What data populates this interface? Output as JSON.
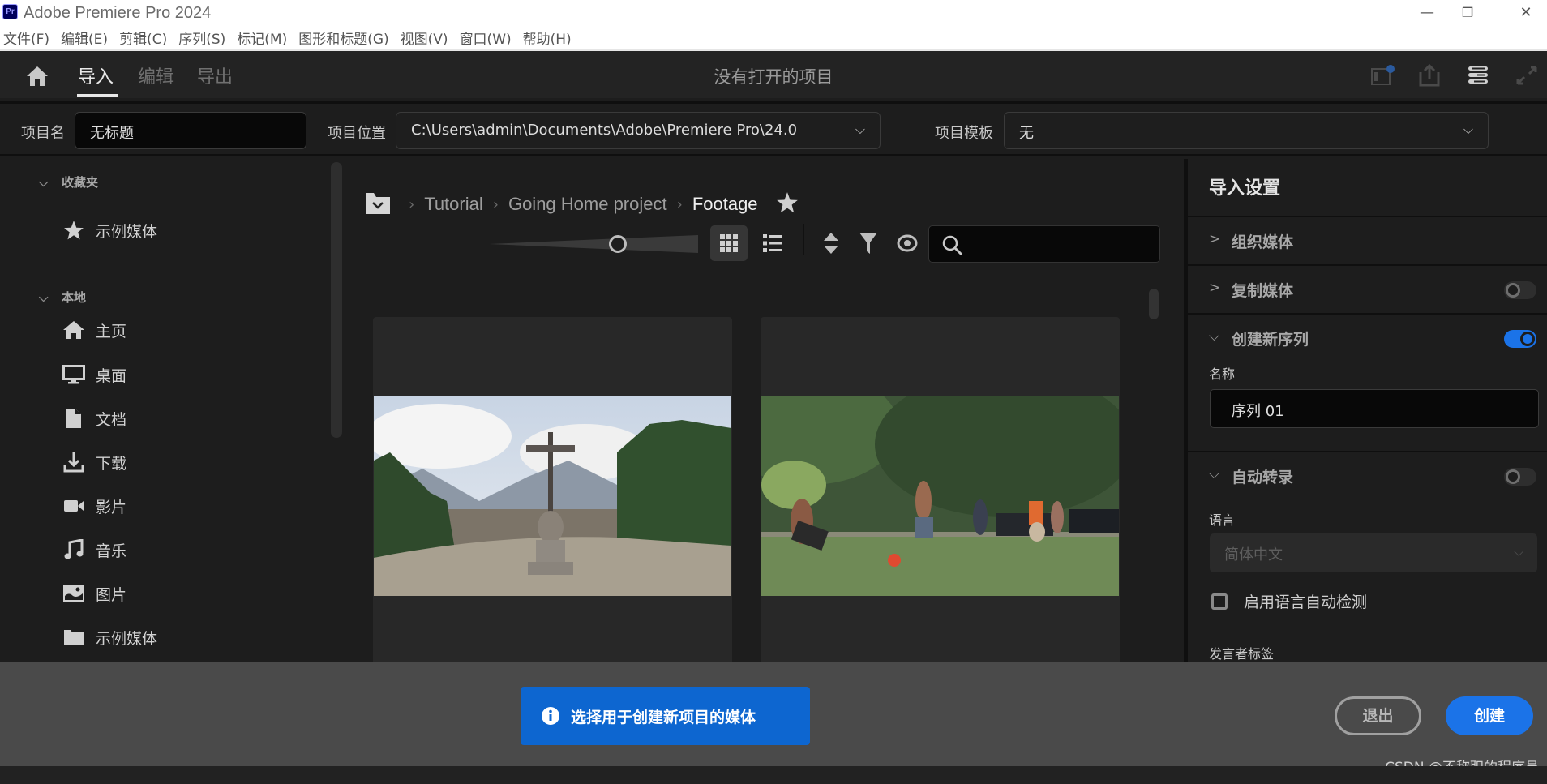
{
  "window": {
    "title": "Adobe Premiere Pro 2024",
    "logo_text": "Pr",
    "controls": {
      "minimize": "—",
      "restore": "❐",
      "close": "✕"
    }
  },
  "menubar": {
    "items": [
      "文件(F)",
      "编辑(E)",
      "剪辑(C)",
      "序列(S)",
      "标记(M)",
      "图形和标题(G)",
      "视图(V)",
      "窗口(W)",
      "帮助(H)"
    ]
  },
  "navbar": {
    "tabs": [
      {
        "label": "导入",
        "active": true
      },
      {
        "label": "编辑",
        "active": false
      },
      {
        "label": "导出",
        "active": false
      }
    ],
    "center_title": "没有打开的项目",
    "right_icons": [
      "quick-export-notify-icon",
      "share-icon",
      "workspaces-icon",
      "fullscreen-icon"
    ]
  },
  "project": {
    "name_label": "项目名",
    "name_value": "无标题",
    "location_label": "项目位置",
    "location_value": "C:\\Users\\admin\\Documents\\Adobe\\Premiere Pro\\24.0",
    "template_label": "项目模板",
    "template_value": "无"
  },
  "sidebar": {
    "favorites_header": "收藏夹",
    "favorites": [
      {
        "label": "示例媒体",
        "icon": "star-icon"
      }
    ],
    "local_header": "本地",
    "local": [
      {
        "label": "主页",
        "icon": "home-icon"
      },
      {
        "label": "桌面",
        "icon": "desktop-icon"
      },
      {
        "label": "文档",
        "icon": "document-icon"
      },
      {
        "label": "下载",
        "icon": "download-icon"
      },
      {
        "label": "影片",
        "icon": "video-camera-icon"
      },
      {
        "label": "音乐",
        "icon": "music-note-icon"
      },
      {
        "label": "图片",
        "icon": "image-icon"
      },
      {
        "label": "示例媒体",
        "icon": "folder-icon"
      }
    ]
  },
  "browser": {
    "breadcrumb": [
      "Tutorial",
      "Going Home project",
      "Footage"
    ],
    "search_placeholder": "",
    "thumbnail_size": 0.6,
    "view_mode": "grid",
    "media": [
      {
        "description": "Cross on hilltop overlooking town and mountains"
      },
      {
        "description": "Children playing soccer on grass field"
      }
    ]
  },
  "import_settings": {
    "title": "导入设置",
    "sections": [
      {
        "label": "组织媒体",
        "expanded": false,
        "toggle": null
      },
      {
        "label": "复制媒体",
        "expanded": false,
        "toggle": false
      },
      {
        "label": "创建新序列",
        "expanded": true,
        "toggle": true
      },
      {
        "label": "自动转录",
        "expanded": true,
        "toggle": false
      }
    ],
    "sequence_name_label": "名称",
    "sequence_name_value": "序列 01",
    "language_label": "语言",
    "language_value": "简体中文",
    "auto_detect_label": "启用语言自动检测",
    "auto_detect_checked": false,
    "speaker_labels_label": "发言者标签"
  },
  "footer": {
    "info_text": "选择用于创建新项目的媒体",
    "exit_label": "退出",
    "create_label": "创建",
    "watermark": "CSDN @不称职的程序员"
  },
  "colors": {
    "accent": "#1b73e8",
    "info_banner": "#0d66d0",
    "background": "#1d1d1d",
    "footer": "#4a4a4a"
  }
}
